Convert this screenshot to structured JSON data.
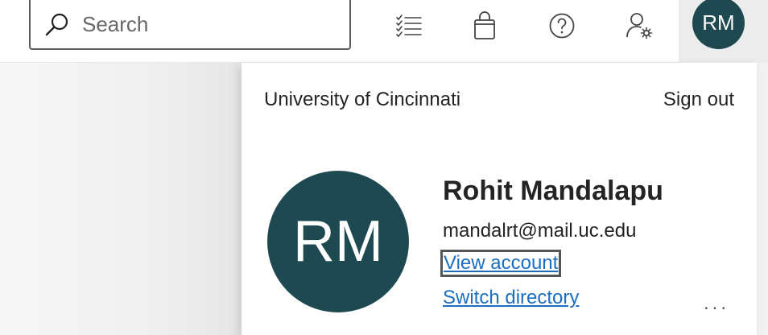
{
  "topbar": {
    "search_placeholder": "Search",
    "icons": [
      "checklist-icon",
      "shopping-bag-icon",
      "help-icon",
      "user-settings-icon"
    ],
    "avatar_initials": "RM"
  },
  "account_panel": {
    "organization": "University of Cincinnati",
    "sign_out_label": "Sign out",
    "avatar_initials": "RM",
    "user_name": "Rohit Mandalapu",
    "email": "mandalrt@mail.uc.edu",
    "view_account_label": "View account",
    "switch_directory_label": "Switch directory",
    "more_label": "..."
  },
  "colors": {
    "avatar_bg": "#1e4950",
    "link": "#1b6ec2"
  }
}
